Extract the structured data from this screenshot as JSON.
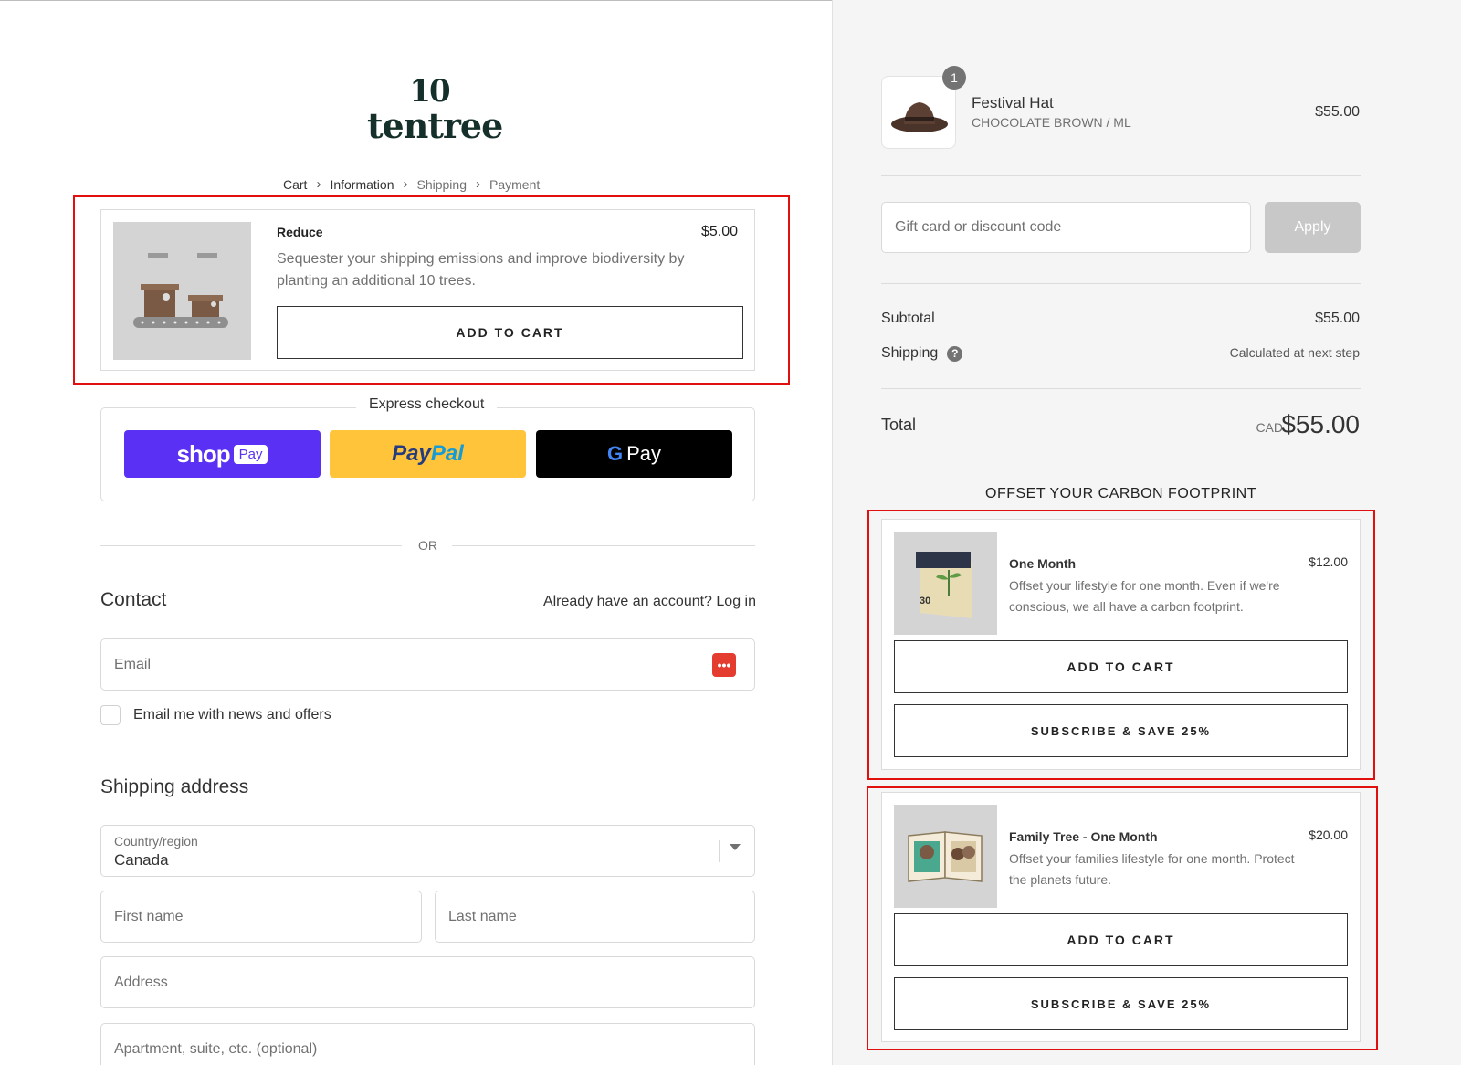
{
  "brand": {
    "logo_mark": "10",
    "logo_text": "tentree"
  },
  "breadcrumb": [
    {
      "label": "Cart"
    },
    {
      "label": "Information"
    },
    {
      "label": "Shipping"
    },
    {
      "label": "Payment"
    }
  ],
  "upsell": {
    "title": "Reduce",
    "price": "$5.00",
    "description": "Sequester your shipping emissions and improve biodiversity by planting an additional 10 trees.",
    "button": "ADD TO CART",
    "image_icon": "conveyor-boxes-illustration"
  },
  "express": {
    "title": "Express checkout",
    "shop_pay": {
      "word": "shop",
      "chip": "Pay"
    },
    "paypal": {
      "a": "Pay",
      "b": "Pal"
    },
    "gpay": {
      "g": "G",
      "label": "Pay"
    }
  },
  "divider_text": "OR",
  "contact": {
    "heading": "Contact",
    "login_prompt": "Already have an account? Log in",
    "email_placeholder": "Email",
    "newsletter_label": "Email me with news and offers"
  },
  "shipping": {
    "heading": "Shipping address",
    "country_label": "Country/region",
    "country_value": "Canada",
    "first_name_placeholder": "First name",
    "last_name_placeholder": "Last name",
    "address_placeholder": "Address",
    "apartment_placeholder": "Apartment, suite, etc. (optional)"
  },
  "order": {
    "item": {
      "quantity": "1",
      "name": "Festival Hat",
      "variant": "CHOCOLATE BROWN / ML",
      "price": "$55.00"
    },
    "discount_placeholder": "Gift card or discount code",
    "apply_label": "Apply",
    "subtotal_label": "Subtotal",
    "subtotal_value": "$55.00",
    "shipping_label": "Shipping",
    "shipping_value": "Calculated at next step",
    "total_label": "Total",
    "currency": "CAD",
    "total_value": "$55.00"
  },
  "offset": {
    "title": "OFFSET YOUR CARBON FOOTPRINT",
    "cards": [
      {
        "title": "One Month",
        "price": "$12.00",
        "description": "Offset your lifestyle for one month. Even if we're conscious, we all have a carbon footprint.",
        "add_label": "ADD TO CART",
        "subscribe_label": "SUBSCRIBE & SAVE 25%",
        "calendar_day": "30"
      },
      {
        "title": "Family Tree - One Month",
        "price": "$20.00",
        "description": "Offset your families lifestyle for one month. Protect the planets future.",
        "add_label": "ADD TO CART",
        "subscribe_label": "SUBSCRIBE & SAVE 25%"
      }
    ]
  },
  "colors": {
    "highlight": "#e20f0f",
    "shop_pay": "#5a31f4",
    "paypal": "#ffc439",
    "gpay": "#000000",
    "panel_bg": "#f5f5f5"
  }
}
